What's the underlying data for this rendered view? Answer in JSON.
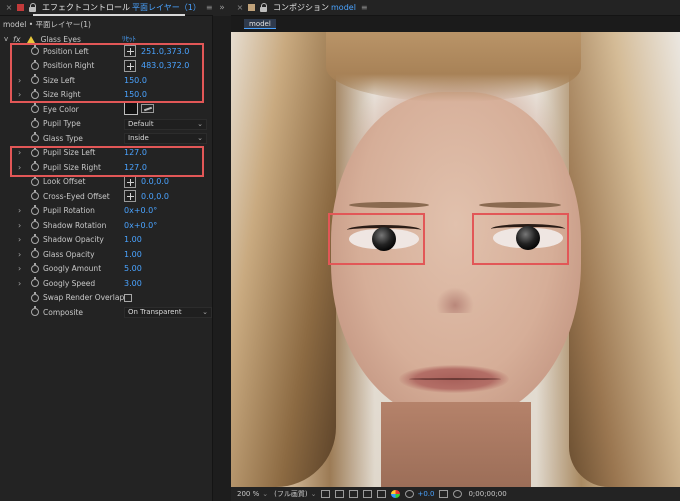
{
  "left_header": {
    "close": "×",
    "title": "エフェクトコントロール",
    "layer_link": "平面レイヤー（1）",
    "menu": "≡"
  },
  "divider": "»",
  "right_header": {
    "close": "×",
    "title": "コンポジション",
    "comp_link": "model",
    "menu": "≡"
  },
  "layer_path": "model • 平面レイヤー(1)",
  "effect": {
    "twirl": "v",
    "fx": "fx",
    "name": "Glass Eyes",
    "reset": "ﾘｾｯﾄ"
  },
  "properties": [
    {
      "name": "Position Left",
      "value": "251.0,373.0",
      "control": "point",
      "twirl": ""
    },
    {
      "name": "Position Right",
      "value": "483.0,372.0",
      "control": "point",
      "twirl": ""
    },
    {
      "name": "Size Left",
      "value": "150.0",
      "control": "number",
      "twirl": "›"
    },
    {
      "name": "Size Right",
      "value": "150.0",
      "control": "number",
      "twirl": "›"
    },
    {
      "name": "Eye Color",
      "value": "",
      "control": "color",
      "twirl": ""
    },
    {
      "name": "Pupil Type",
      "value": "Default",
      "control": "dropdown",
      "twirl": ""
    },
    {
      "name": "Glass Type",
      "value": "Inside",
      "control": "dropdown",
      "twirl": ""
    },
    {
      "name": "Pupil Size Left",
      "value": "127.0",
      "control": "number",
      "twirl": "›"
    },
    {
      "name": "Pupil Size Right",
      "value": "127.0",
      "control": "number",
      "twirl": "›"
    },
    {
      "name": "Look Offset",
      "value": "0.0,0.0",
      "control": "point",
      "twirl": ""
    },
    {
      "name": "Cross-Eyed Offset",
      "value": "0.0,0.0",
      "control": "point",
      "twirl": ""
    },
    {
      "name": "Pupil Rotation",
      "value": "0x+0.0°",
      "control": "number",
      "twirl": "›"
    },
    {
      "name": "Shadow Rotation",
      "value": "0x+0.0°",
      "control": "number",
      "twirl": "›"
    },
    {
      "name": "Shadow Opacity",
      "value": "1.00",
      "control": "number",
      "twirl": "›"
    },
    {
      "name": "Glass Opacity",
      "value": "1.00",
      "control": "number",
      "twirl": "›"
    },
    {
      "name": "Googly Amount",
      "value": "5.00",
      "control": "number",
      "twirl": "›"
    },
    {
      "name": "Googly Speed",
      "value": "3.00",
      "control": "number",
      "twirl": "›"
    },
    {
      "name": "Swap Render Overlap",
      "value": "",
      "control": "checkbox",
      "twirl": ""
    },
    {
      "name": "Composite",
      "value": "On Transparent",
      "control": "dropdown",
      "twirl": ""
    }
  ],
  "comp_tab": "model",
  "bottom_bar": {
    "zoom": "200 %",
    "zoom_chev": "⌄",
    "quality": "(フル画質)",
    "quality_chev": "⌄",
    "exposure": "+0.0",
    "timecode": "0;00;00;00"
  },
  "colors": {
    "accent": "#4aa3ff",
    "highlight": "#e25757",
    "warning": "#e8c73a"
  }
}
